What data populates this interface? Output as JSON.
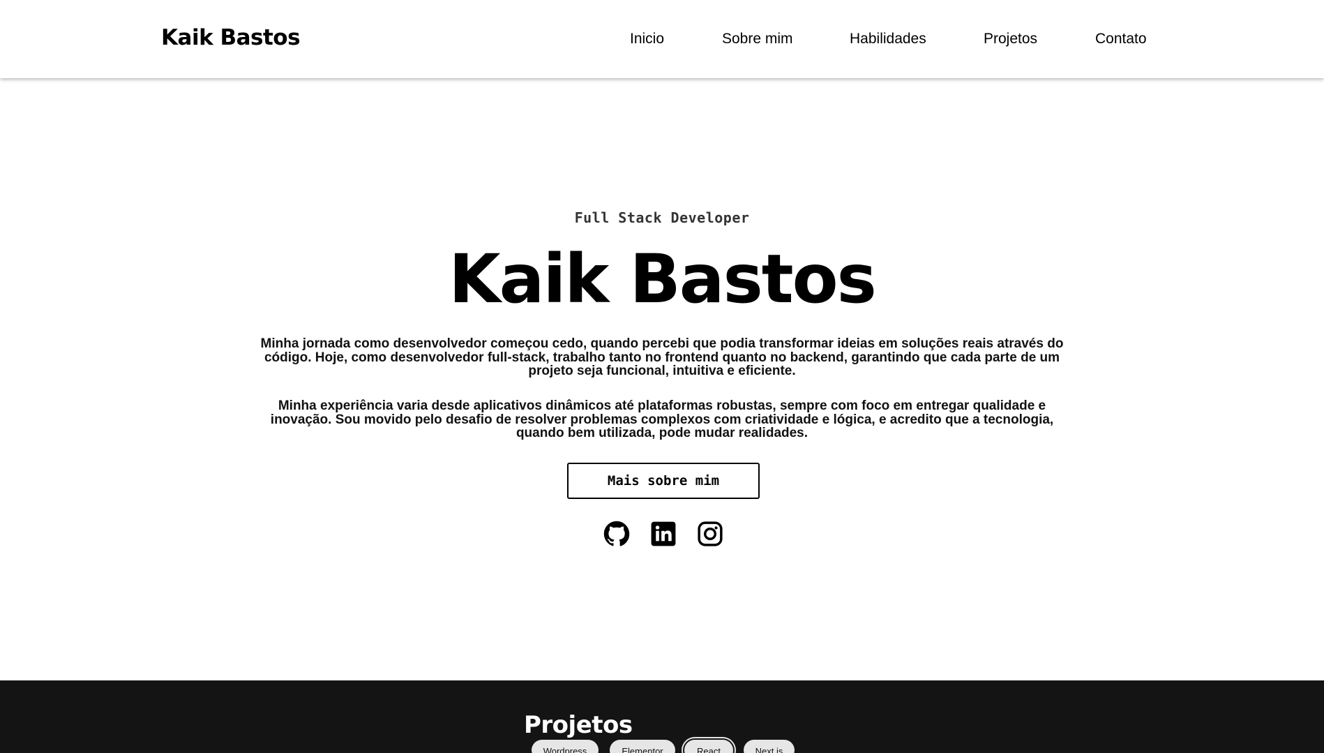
{
  "header": {
    "brand": "Kaik Bastos",
    "nav": [
      "Inicio",
      "Sobre mim",
      "Habilidades",
      "Projetos",
      "Contato"
    ]
  },
  "hero": {
    "role": "Full Stack Developer",
    "name": "Kaik Bastos",
    "bio": [
      "Minha jornada como desenvolvedor começou cedo, quando percebi que podia transformar ideias em soluções reais através do código. Hoje, como desenvolvedor full-stack, trabalho tanto no frontend quanto no backend, garantindo que cada parte de um projeto seja funcional, intuitiva e eficiente.",
      "Minha experiência varia desde aplicativos dinâmicos até plataformas robustas, sempre com foco em entregar qualidade e inovação. Sou movido pelo desafio de resolver problemas complexos com criatividade e lógica, e acredito que a tecnologia, quando bem utilizada, pode mudar realidades."
    ],
    "cta": "Mais sobre mim",
    "socials": [
      "github-icon",
      "linkedin-icon",
      "instagram-icon"
    ]
  },
  "projects": {
    "title": "Projetos",
    "filters": [
      "Wordpress",
      "Elementor",
      "React",
      "Next.js"
    ],
    "active_filter": "React"
  },
  "colors": {
    "background": "#ffffff",
    "text": "#000000",
    "projects_background": "#141414",
    "chip_background": "#e6e6e6"
  }
}
